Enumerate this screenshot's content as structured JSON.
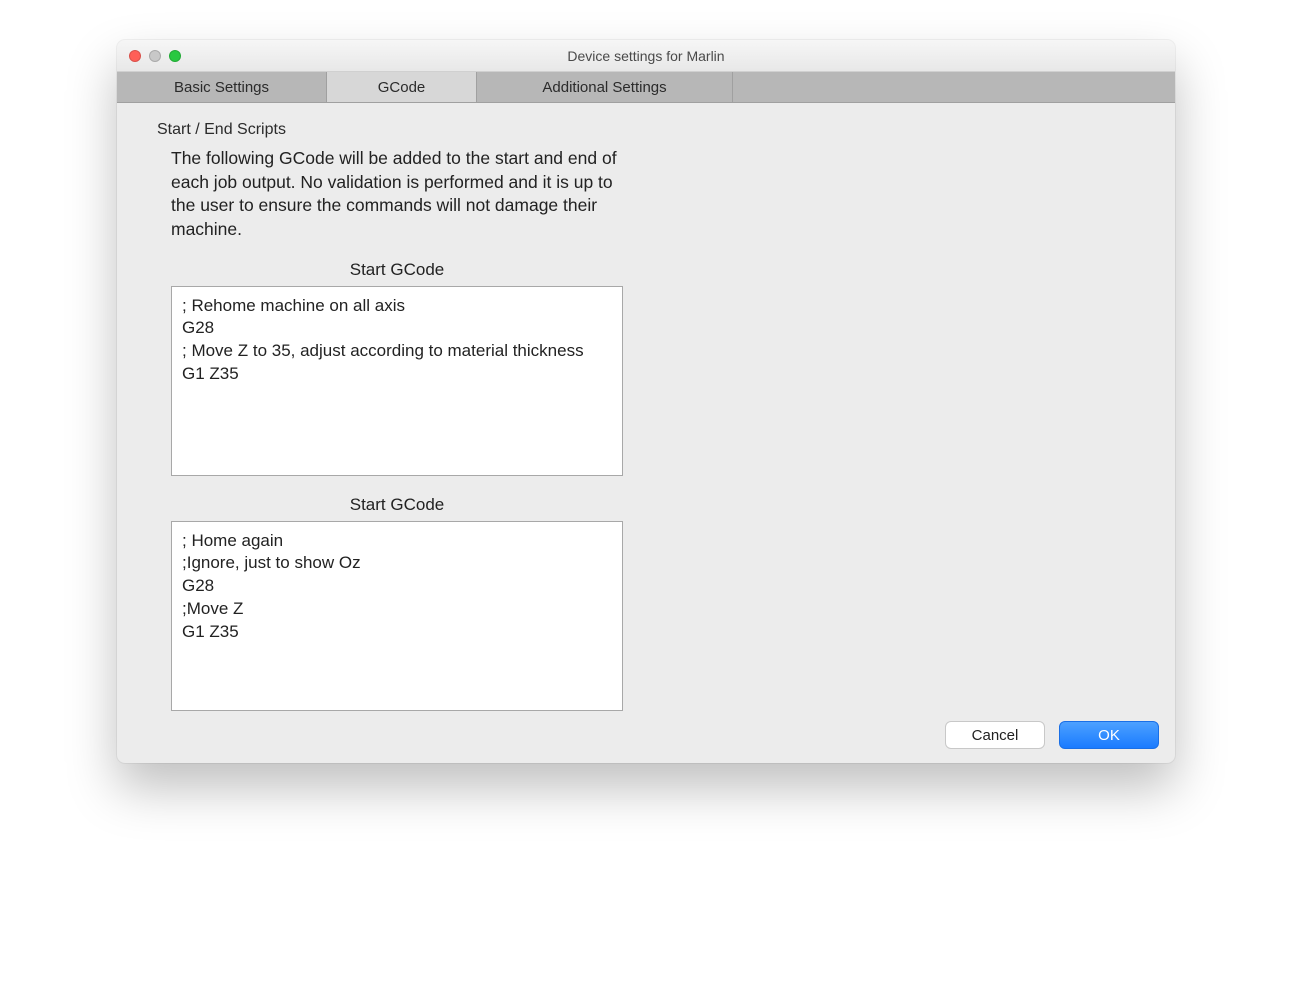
{
  "window": {
    "title": "Device settings for Marlin"
  },
  "tabs": {
    "basic": "Basic Settings",
    "gcode": "GCode",
    "additional": "Additional Settings"
  },
  "section": {
    "scripts_label": "Start / End Scripts",
    "description": "The following GCode will be added to the start and end of each job output. No validation is performed and it is up to the user to ensure the commands will not damage their machine.",
    "start_label_1": "Start GCode",
    "start_code_1": "; Rehome machine on all axis\nG28\n; Move Z to 35, adjust according to material thickness\nG1 Z35",
    "start_label_2": "Start GCode",
    "start_code_2": "; Home again\n;Ignore, just to show Oz\nG28\n;Move Z\nG1 Z35"
  },
  "buttons": {
    "cancel": "Cancel",
    "ok": "OK"
  }
}
